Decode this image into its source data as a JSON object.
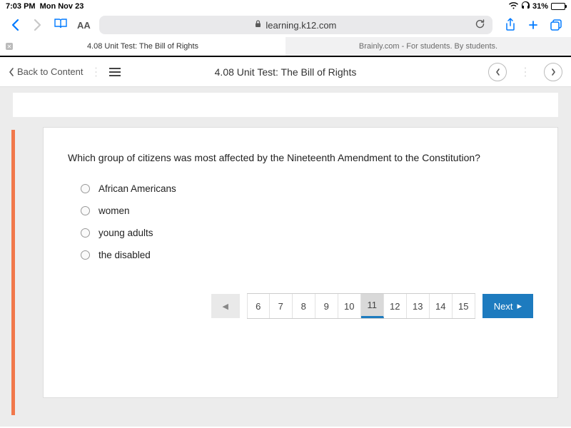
{
  "status": {
    "time": "7:03 PM",
    "date": "Mon Nov 23",
    "battery_pct": "31%"
  },
  "browser": {
    "aa": "AA",
    "url_host": "learning.k12.com",
    "tabs": [
      {
        "label": "4.08 Unit Test: The Bill of Rights",
        "active": true
      },
      {
        "label": "Brainly.com - For students. By students.",
        "active": false
      }
    ]
  },
  "header": {
    "back_label": "Back to Content",
    "title": "4.08 Unit Test: The Bill of Rights"
  },
  "quiz": {
    "question": "Which group of citizens was most affected by the Nineteenth Amendment to the Constitution?",
    "options": [
      "African Americans",
      "women",
      "young adults",
      "the disabled"
    ]
  },
  "pagination": {
    "pages": [
      "6",
      "7",
      "8",
      "9",
      "10",
      "11",
      "12",
      "13",
      "14",
      "15"
    ],
    "current": "11",
    "next_label": "Next"
  }
}
